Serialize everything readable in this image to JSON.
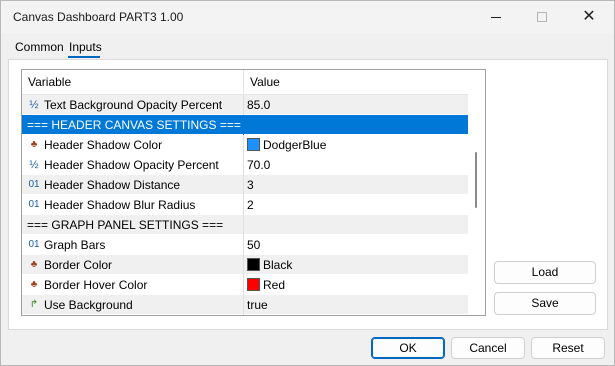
{
  "window": {
    "title": "Canvas Dashboard PART3 1.00"
  },
  "tabs": [
    {
      "label": "Common",
      "active": false
    },
    {
      "label": "Inputs",
      "active": true
    }
  ],
  "table": {
    "headers": {
      "variable": "Variable",
      "value": "Value"
    },
    "rows": [
      {
        "icon": "half-icon",
        "glyph": "½",
        "variable": "Text Background Opacity Percent",
        "value": "85.0",
        "style": "alt"
      },
      {
        "icon": "",
        "glyph": "",
        "variable": "=== HEADER CANVAS SETTINGS ===",
        "value": "",
        "style": "selected"
      },
      {
        "icon": "color-icon",
        "glyph": "♣",
        "variable": "Header Shadow Color",
        "value": "DodgerBlue",
        "swatch": "#1e90ff",
        "style": "plain"
      },
      {
        "icon": "half-icon",
        "glyph": "½",
        "variable": "Header Shadow Opacity Percent",
        "value": "70.0",
        "style": "plain"
      },
      {
        "icon": "integer-icon",
        "glyph": "01",
        "variable": "Header Shadow Distance",
        "value": "3",
        "style": "alt"
      },
      {
        "icon": "integer-icon",
        "glyph": "01",
        "variable": "Header Shadow Blur Radius",
        "value": "2",
        "style": "plain"
      },
      {
        "icon": "",
        "glyph": "",
        "variable": "=== GRAPH PANEL SETTINGS ===",
        "value": "",
        "style": "alt"
      },
      {
        "icon": "integer-icon",
        "glyph": "01",
        "variable": "Graph Bars",
        "value": "50",
        "style": "plain"
      },
      {
        "icon": "color-icon",
        "glyph": "♣",
        "variable": "Border Color",
        "value": "Black",
        "swatch": "#000000",
        "style": "alt"
      },
      {
        "icon": "color-icon",
        "glyph": "♣",
        "variable": "Border Hover Color",
        "value": "Red",
        "swatch": "#ff0000",
        "style": "plain"
      },
      {
        "icon": "bool-icon",
        "glyph": "↱",
        "variable": "Use Background",
        "value": "true",
        "style": "alt"
      }
    ]
  },
  "side_buttons": {
    "load": "Load",
    "save": "Save"
  },
  "bottom_buttons": {
    "ok": "OK",
    "cancel": "Cancel",
    "reset": "Reset"
  },
  "colors": {
    "accent": "#0078d7",
    "selection": "#0078d7"
  }
}
